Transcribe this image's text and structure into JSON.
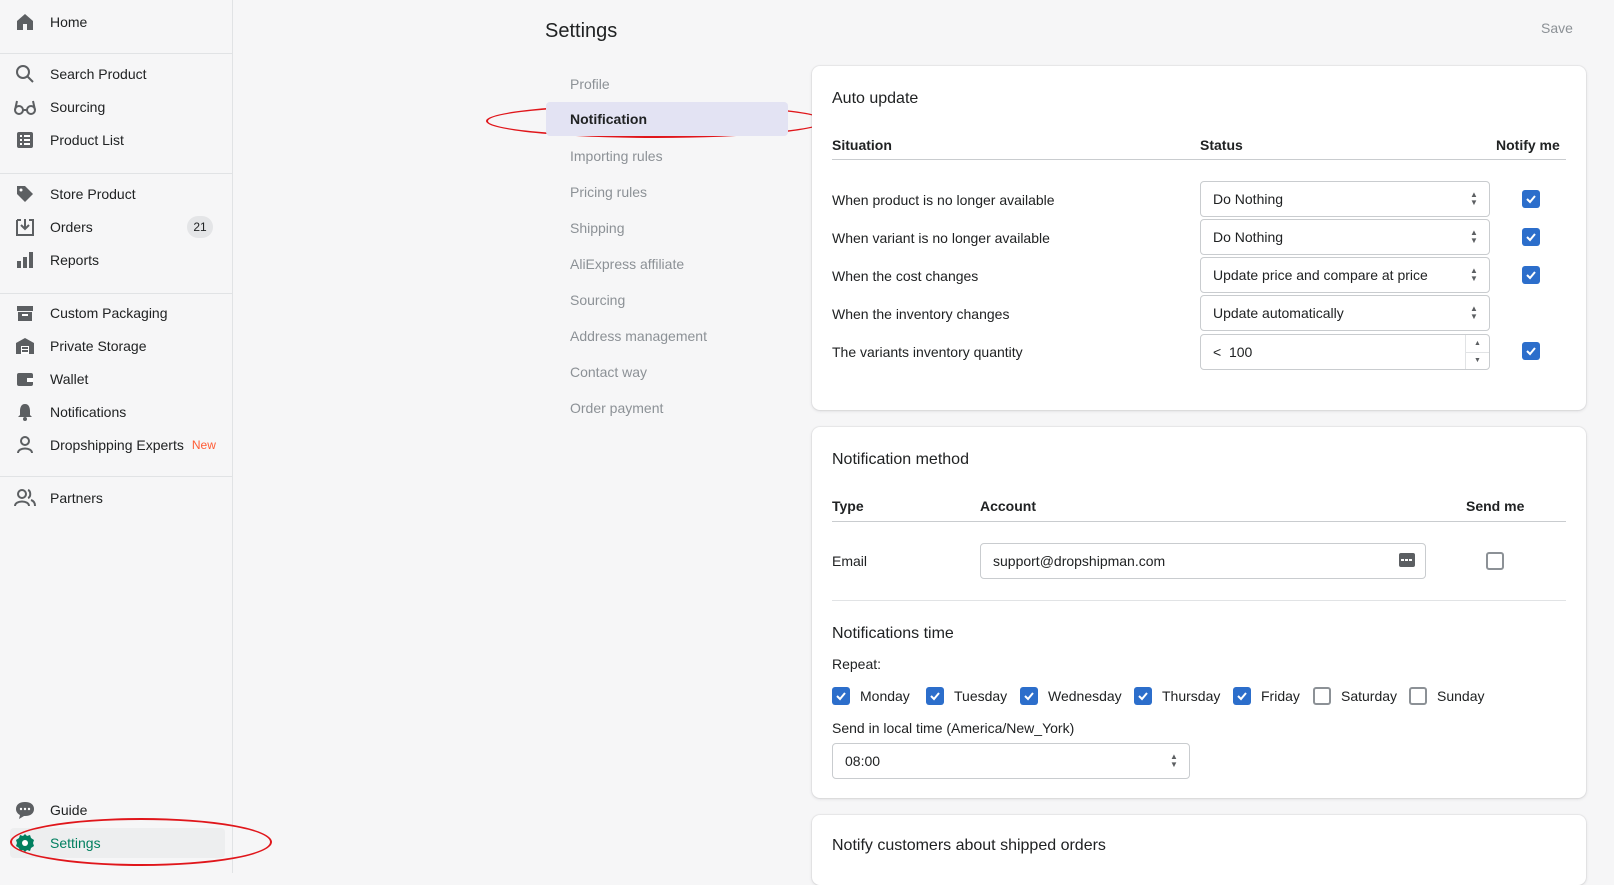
{
  "sidebar": {
    "home": "Home",
    "search_product": "Search Product",
    "sourcing": "Sourcing",
    "product_list": "Product List",
    "store_product": "Store Product",
    "orders": "Orders",
    "orders_count": "21",
    "reports": "Reports",
    "custom_packaging": "Custom Packaging",
    "private_storage": "Private Storage",
    "wallet": "Wallet",
    "notifications": "Notifications",
    "dropshipping_experts": "Dropshipping Experts",
    "new_tag": "New",
    "partners": "Partners",
    "guide": "Guide",
    "settings": "Settings"
  },
  "header": {
    "title": "Settings",
    "save": "Save"
  },
  "settings_nav": [
    "Profile",
    "Notification",
    "Importing rules",
    "Pricing rules",
    "Shipping",
    "AliExpress affiliate",
    "Sourcing",
    "Address management",
    "Contact way",
    "Order payment"
  ],
  "auto_update": {
    "title": "Auto update",
    "col_situation": "Situation",
    "col_status": "Status",
    "col_notify": "Notify me",
    "rows": [
      {
        "label": "When product is no longer available",
        "status": "Do Nothing",
        "notify": true
      },
      {
        "label": "When variant is no longer available",
        "status": "Do Nothing",
        "notify": true
      },
      {
        "label": "When the cost changes",
        "status": "Update price and compare at price",
        "notify": true
      },
      {
        "label": "When the inventory changes",
        "status": "Update automatically",
        "notify": null
      },
      {
        "label": "The variants inventory quantity",
        "status": "<  100",
        "notify": true
      }
    ]
  },
  "notification_method": {
    "title": "Notification method",
    "col_type": "Type",
    "col_account": "Account",
    "col_send": "Send me",
    "type": "Email",
    "account": "support@dropshipman.com",
    "send_me": false
  },
  "notifications_time": {
    "title": "Notifications time",
    "repeat_label": "Repeat:",
    "days": [
      {
        "label": "Monday",
        "checked": true
      },
      {
        "label": "Tuesday",
        "checked": true
      },
      {
        "label": "Wednesday",
        "checked": true
      },
      {
        "label": "Thursday",
        "checked": true
      },
      {
        "label": "Friday",
        "checked": true
      },
      {
        "label": "Saturday",
        "checked": false
      },
      {
        "label": "Sunday",
        "checked": false
      }
    ],
    "local_time_label": "Send in local time (America/New_York)",
    "time_value": "08:00"
  },
  "shipped_orders": {
    "title": "Notify customers about shipped orders"
  },
  "colors": {
    "accent": "#2c6ecb",
    "active_settings": "#007f5f",
    "annotation": "#e0161b",
    "new_tag": "#ff5c35"
  }
}
